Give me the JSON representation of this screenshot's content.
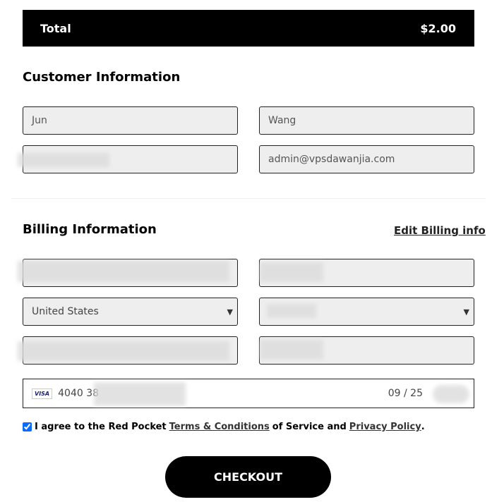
{
  "total": {
    "label": "Total",
    "amount": "$2.00"
  },
  "customer": {
    "title": "Customer Information",
    "first_name": "Jun",
    "last_name": "Wang",
    "email": "admin@vpsdawanjia.com"
  },
  "billing": {
    "title": "Billing Information",
    "edit_link": "Edit Billing info",
    "country": "United States"
  },
  "card": {
    "brand": "VISA",
    "number_prefix": "4040 38",
    "expiry": "09 / 25"
  },
  "agree": {
    "text1": "I agree to the Red Pocket",
    "terms": "Terms & Conditions",
    "text2": "of Service and",
    "privacy": "Privacy Policy",
    "period": ".",
    "checked": true
  },
  "checkout_label": "CHECKOUT"
}
